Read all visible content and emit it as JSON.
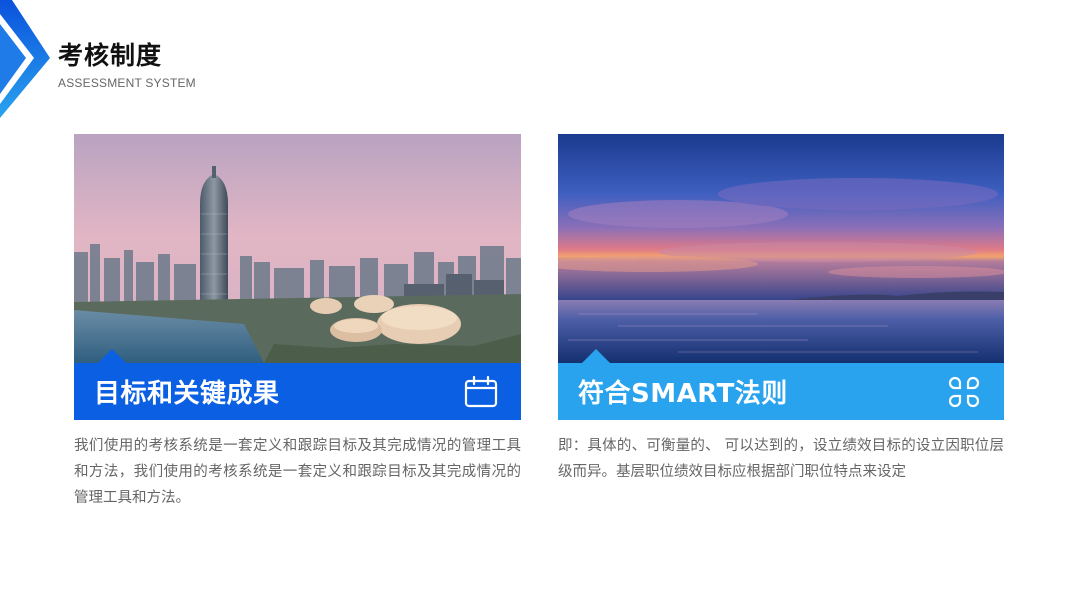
{
  "header": {
    "title": "考核制度",
    "subtitle": "ASSESSMENT SYSTEM"
  },
  "cards": [
    {
      "heading": "目标和关键成果",
      "icon": "calendar-icon",
      "banner_color": "#0b5fe3",
      "photo": "city-skyline-photo",
      "description": "我们使用的考核系统是一套定义和跟踪目标及其完成情况的管理工具和方法，我们使用的考核系统是一套定义和跟踪目标及其完成情况的管理工具和方法。"
    },
    {
      "heading": "符合SMART法则",
      "icon": "command-icon",
      "banner_color": "#2aa3ee",
      "photo": "sunset-lake-photo",
      "description": "即：具体的、可衡量的、 可以达到的，设立绩效目标的设立因职位层级而异。基层职位绩效目标应根据部门职位特点来设定"
    }
  ],
  "colors": {
    "accent_blue": "#0b5fe3",
    "accent_light_blue": "#2aa3ee",
    "title_text": "#111111",
    "body_text": "#666666"
  }
}
